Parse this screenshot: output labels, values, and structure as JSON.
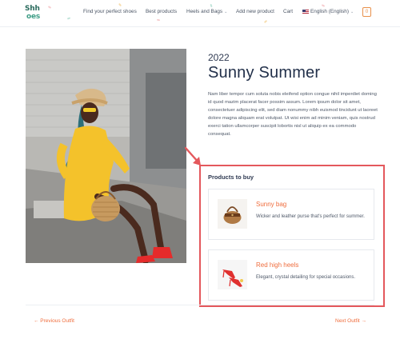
{
  "header": {
    "logo_line1": "Shh",
    "logo_line2": "oes",
    "nav": [
      {
        "label": "Find your perfect shoes"
      },
      {
        "label": "Best products"
      },
      {
        "label": "Heels and Bags"
      },
      {
        "label": "Add new product"
      },
      {
        "label": "Cart"
      },
      {
        "label": "English (English)"
      }
    ],
    "cart_count": "0"
  },
  "post": {
    "year": "2022",
    "title": "Sunny Summer",
    "description": "Nam liber tempor cum soluta nobis eleifend option congue nihil imperdiet doming id quod mazim placerat facer possim assum. Lorem ipsum dolor sit amet, consectetuer adipiscing elit, sed diam nonummy nibh euismod tincidunt ut laoreet dolore magna aliquam erat volutpat. Ut wisi enim ad minim veniam, quis nostrud exerci tation ullamcorper suscipit lobortis nisl ut aliquip ex ea commodo consequat."
  },
  "products": {
    "heading": "Products to buy",
    "items": [
      {
        "name": "Sunny bag",
        "description": "Wicker and leather purse that's perfect for summer."
      },
      {
        "name": "Red high heels",
        "description": "Elegant, crystal detailing for special occasions."
      }
    ]
  },
  "pagination": {
    "prev": "← Previous Outfit",
    "next": "Next Outfit →"
  },
  "colors": {
    "accent": "#ef6d3d",
    "highlight": "#e4585c",
    "logo": "#2a6b5d"
  }
}
